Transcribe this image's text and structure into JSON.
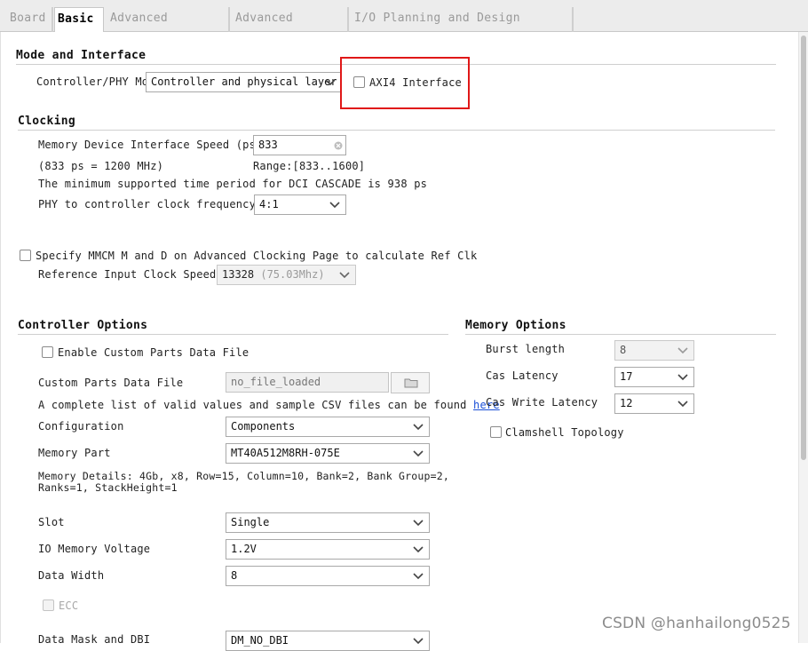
{
  "tabs": [
    "Board",
    "Basic",
    "Advanced Clocking",
    "Advanced Options",
    "I/O Planning and Design Checklist"
  ],
  "mode_interface": {
    "title": "Mode and Interface",
    "controller_phy_label": "Controller/PHY Mode",
    "controller_phy_value": "Controller and physical layer",
    "axi4_label": "AXI4 Interface"
  },
  "clocking": {
    "title": "Clocking",
    "speed_label": "Memory Device Interface Speed (ps)",
    "speed_value": "833",
    "speed_mhz": "(833 ps = 1200 MHz)",
    "range": "Range:[833..1600]",
    "min_period_note": "The minimum supported time period for DCI CASCADE is 938 ps",
    "ratio_label": "PHY to controller clock frequency ratio",
    "ratio_value": "4:1",
    "mmcm_label": "Specify MMCM M and D on Advanced Clocking Page to calculate Ref Clk",
    "ref_clock_label": "Reference Input Clock Speed (ps)",
    "ref_clock_value": "13328",
    "ref_clock_hint": "(75.03Mhz)"
  },
  "controller_options": {
    "title": "Controller Options",
    "custom_parts_enable_label": "Enable Custom Parts Data File",
    "custom_parts_file_label": "Custom Parts Data File",
    "custom_parts_file_value": "no_file_loaded",
    "csv_note": "A complete list of valid values and sample CSV files can be found",
    "csv_link": "here",
    "configuration_label": "Configuration",
    "configuration_value": "Components",
    "memory_part_label": "Memory Part",
    "memory_part_value": "MT40A512M8RH-075E",
    "memory_details_line1": "Memory Details: 4Gb, x8, Row=15, Column=10, Bank=2, Bank Group=2,",
    "memory_details_line2": "Ranks=1, StackHeight=1",
    "slot_label": "Slot",
    "slot_value": "Single",
    "io_voltage_label": "IO Memory Voltage",
    "io_voltage_value": "1.2V",
    "data_width_label": "Data Width",
    "data_width_value": "8",
    "ecc_label": "ECC",
    "data_mask_label": "Data Mask and DBI",
    "data_mask_value": "DM_NO_DBI"
  },
  "memory_options": {
    "title": "Memory Options",
    "burst_length_label": "Burst length",
    "burst_length_value": "8",
    "cas_latency_label": "Cas Latency",
    "cas_latency_value": "17",
    "cas_write_latency_label": "Cas Write Latency",
    "cas_write_latency_value": "12",
    "clamshell_label": "Clamshell Topology"
  },
  "watermark": "CSDN @hanhailong0525",
  "colors": {
    "highlight": "#e01818",
    "link": "#1a4fd6"
  }
}
